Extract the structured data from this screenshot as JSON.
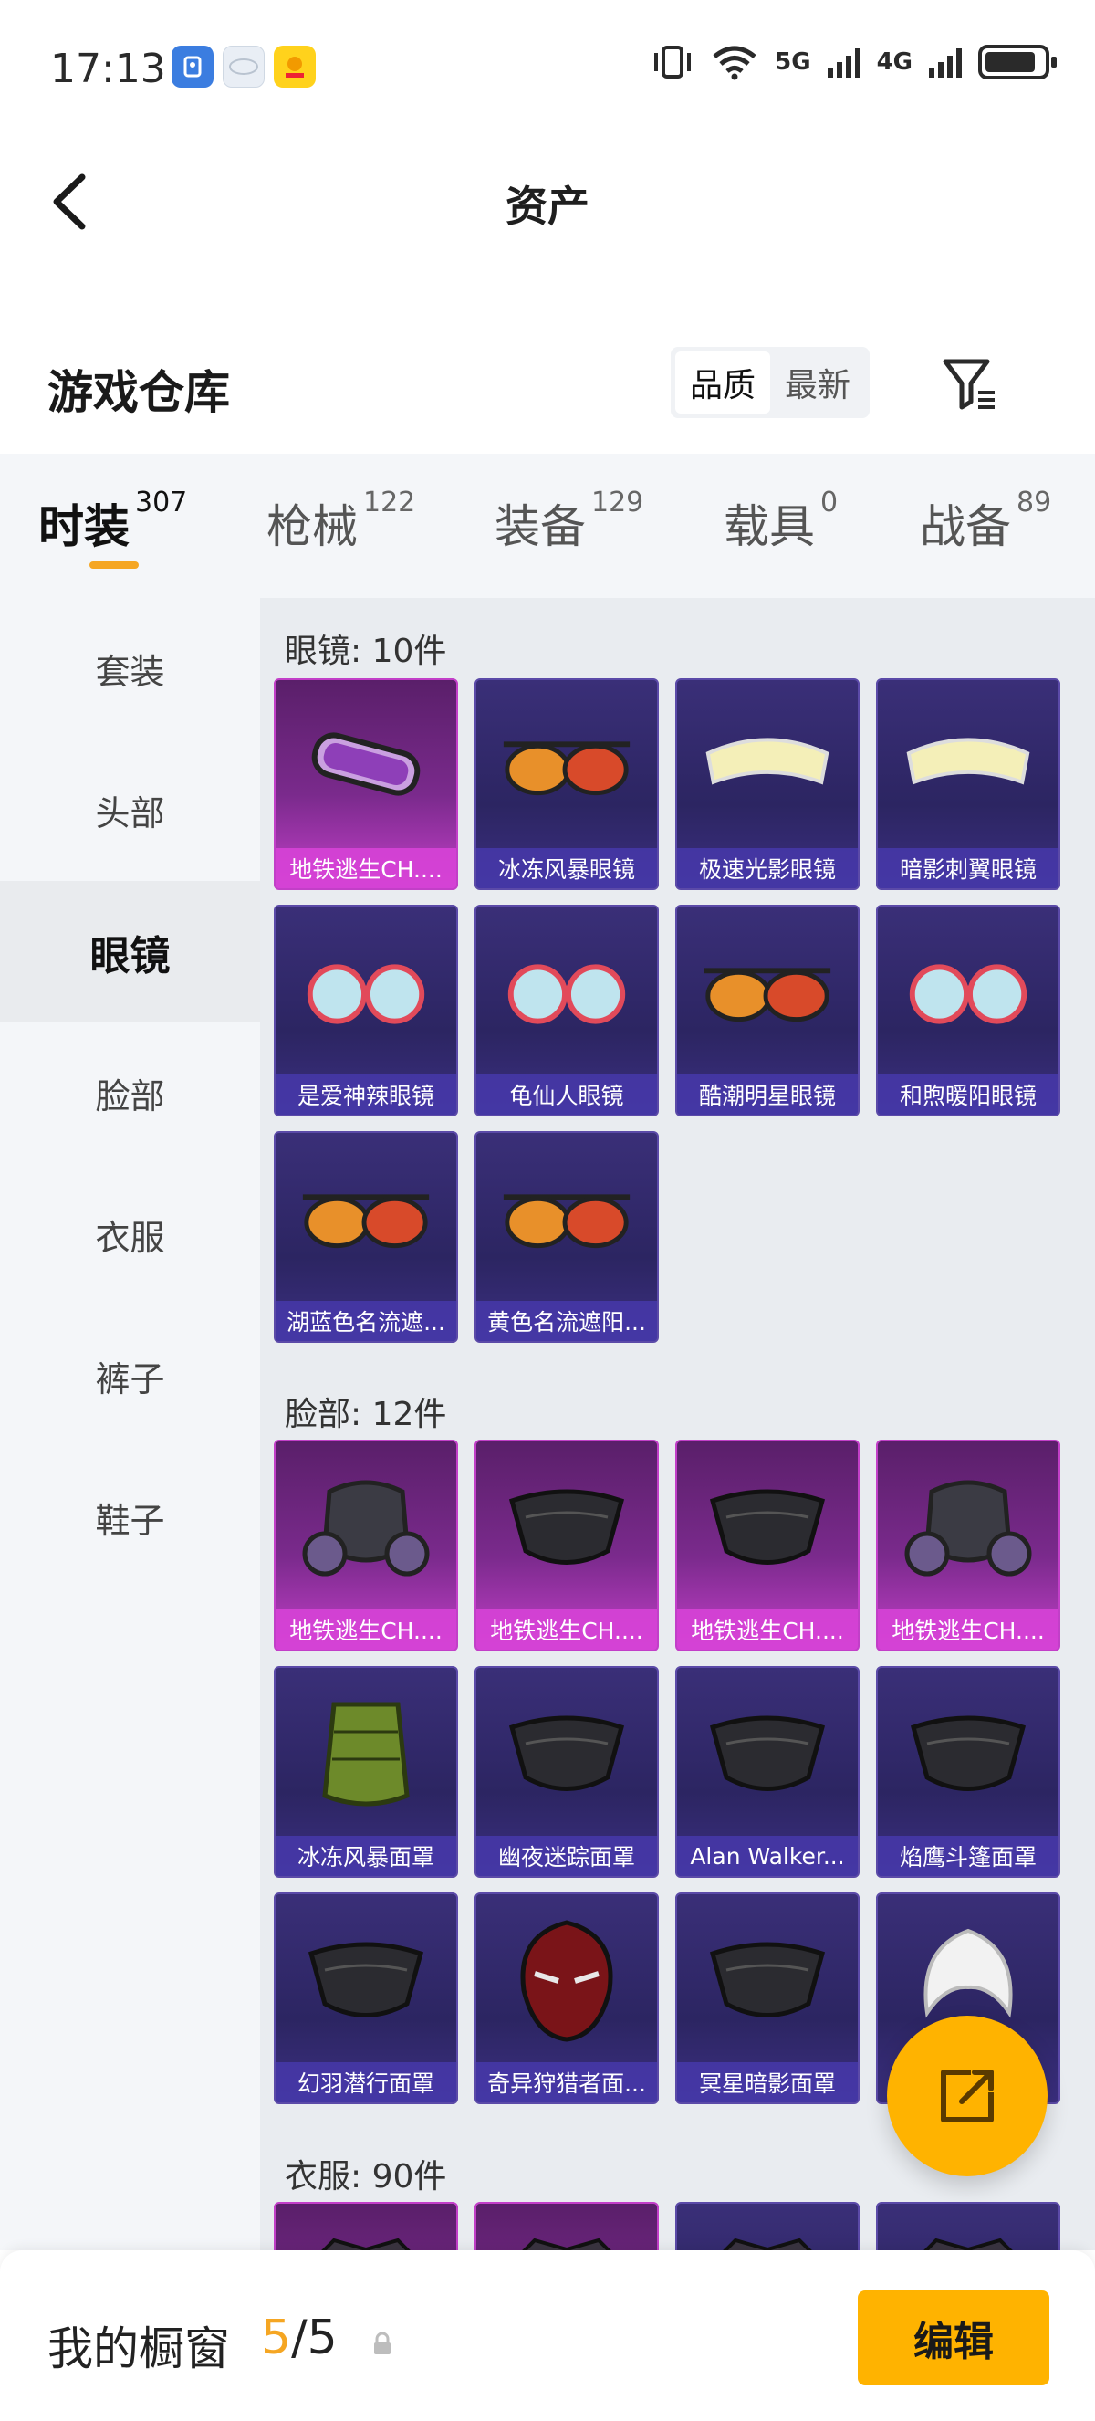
{
  "status_bar": {
    "time": "17:13",
    "network_left": "5G",
    "network_right": "4G"
  },
  "header": {
    "title": "资产"
  },
  "warehouse": {
    "title": "游戏仓库",
    "sort_options": [
      "品质",
      "最新"
    ],
    "active_sort": "品质"
  },
  "categories": [
    {
      "label": "时装",
      "count": "307",
      "active": true
    },
    {
      "label": "枪械",
      "count": "122",
      "active": false
    },
    {
      "label": "装备",
      "count": "129",
      "active": false
    },
    {
      "label": "载具",
      "count": "0",
      "active": false
    },
    {
      "label": "战备",
      "count": "89",
      "active": false
    }
  ],
  "sidebar": {
    "items": [
      "套装",
      "头部",
      "眼镜",
      "脸部",
      "衣服",
      "裤子",
      "鞋子"
    ],
    "active": "眼镜"
  },
  "sections": [
    {
      "title": "眼镜: 10件",
      "items": [
        {
          "name": "地铁逃生CH....",
          "rarity": "epic",
          "icon": "goggles-icon"
        },
        {
          "name": "冰冻风暴眼镜",
          "rarity": "rare",
          "icon": "sunglasses-icon"
        },
        {
          "name": "极速光影眼镜",
          "rarity": "rare",
          "icon": "visor-icon"
        },
        {
          "name": "暗影刺翼眼镜",
          "rarity": "rare",
          "icon": "visor-icon"
        },
        {
          "name": "是爱神辣眼镜",
          "rarity": "rare",
          "icon": "glasses-icon"
        },
        {
          "name": "龟仙人眼镜",
          "rarity": "rare",
          "icon": "glasses-icon"
        },
        {
          "name": "酷潮明星眼镜",
          "rarity": "rare",
          "icon": "sunglasses-icon"
        },
        {
          "name": "和煦暖阳眼镜",
          "rarity": "rare",
          "icon": "glasses-icon"
        },
        {
          "name": "湖蓝色名流遮...",
          "rarity": "rare",
          "icon": "sunglasses-icon"
        },
        {
          "name": "黄色名流遮阳...",
          "rarity": "rare",
          "icon": "sunglasses-icon"
        }
      ]
    },
    {
      "title": "脸部: 12件",
      "items": [
        {
          "name": "地铁逃生CH....",
          "rarity": "epic",
          "icon": "gas-mask-icon"
        },
        {
          "name": "地铁逃生CH....",
          "rarity": "epic",
          "icon": "mask-icon"
        },
        {
          "name": "地铁逃生CH....",
          "rarity": "epic",
          "icon": "mask-icon"
        },
        {
          "name": "地铁逃生CH....",
          "rarity": "epic",
          "icon": "gas-mask-icon"
        },
        {
          "name": "冰冻风暴面罩",
          "rarity": "rare",
          "icon": "scarf-icon"
        },
        {
          "name": "幽夜迷踪面罩",
          "rarity": "rare",
          "icon": "mask-icon"
        },
        {
          "name": "Alan Walker...",
          "rarity": "rare",
          "icon": "mask-icon"
        },
        {
          "name": "焰鹰斗篷面罩",
          "rarity": "rare",
          "icon": "mask-icon"
        },
        {
          "name": "幻羽潜行面罩",
          "rarity": "rare",
          "icon": "mask-icon"
        },
        {
          "name": "奇异狩猎者面...",
          "rarity": "rare",
          "icon": "hood-icon"
        },
        {
          "name": "冥星暗影面罩",
          "rarity": "rare",
          "icon": "mask-icon"
        },
        {
          "name": "",
          "rarity": "rare",
          "icon": "hair-icon"
        }
      ]
    },
    {
      "title": "衣服: 90件",
      "items": [
        {
          "name": "",
          "rarity": "epic",
          "icon": "clothes-icon"
        },
        {
          "name": "",
          "rarity": "epic",
          "icon": "clothes-icon"
        },
        {
          "name": "",
          "rarity": "rare",
          "icon": "clothes-icon"
        },
        {
          "name": "",
          "rarity": "rare",
          "icon": "clothes-icon"
        }
      ]
    }
  ],
  "bottom_bar": {
    "label": "我的橱窗",
    "current": "5",
    "separator": "/",
    "total": "5",
    "edit_label": "编辑"
  },
  "colors": {
    "accent": "#ffb300",
    "count_highlight": "#f5a623",
    "epic_border": "#c23fc8",
    "rare_border": "#5b4aa8"
  }
}
